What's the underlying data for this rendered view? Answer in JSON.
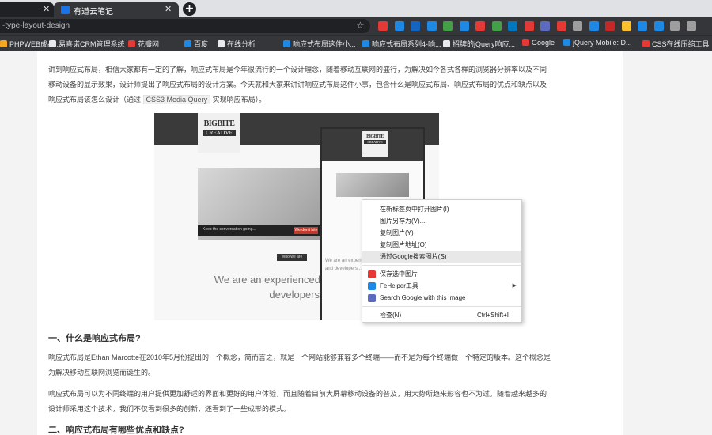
{
  "tabs": {
    "active_title": "有道云笔记",
    "close_glyph": "✕",
    "new_tab_glyph": "+"
  },
  "toolbar": {
    "url": "-type-layout-design",
    "star_glyph": "☆",
    "extension_colors": [
      "#e53935",
      "#1e88e5",
      "#1565c0",
      "#1e88e5",
      "#43a047",
      "#1e88e5",
      "#e53935",
      "#43a047",
      "#0277bd",
      "#e53935",
      "#5c6bc0",
      "#e53935",
      "#9e9e9e",
      "#1e88e5",
      "#c62828",
      "#fbc02d",
      "#1e88e5",
      "#1e88e5",
      "#9e9e9e",
      "#9e9e9e"
    ]
  },
  "bookmarks": [
    {
      "label": "PHPWEB成品...",
      "color": "#f5a623"
    },
    {
      "label": "易喜诺CRM管理系统",
      "color": "#e8eaed"
    },
    {
      "label": "花瓣网",
      "color": "#e53935"
    },
    {
      "label": "百度",
      "color": "#1e88e5"
    },
    {
      "label": "在线分析",
      "color": "#e8eaed"
    },
    {
      "label": "响应式布局这件小...",
      "color": "#1e88e5"
    },
    {
      "label": "响应式布局系列4-响...",
      "color": "#1e88e5"
    },
    {
      "label": "招牌的jQuery响应...",
      "color": "#e8eaed"
    },
    {
      "label": "Google",
      "color": "#e53935"
    },
    {
      "label": "jQuery Mobile: D...",
      "color": "#1e88e5"
    },
    {
      "label": "CSS在线压缩工具",
      "color": "#e53935"
    }
  ],
  "article": {
    "intro_part1": "讲到响应式布局，相信大家都有一定的了解，响应式布局是今年很流行的一个设计理念，随着移动互联网的盛行，为解决如今各式各样的浏览器分辨率以及不同移动设备的显示效果，设计师提出了响应式布局的设计方案。今天就和大家来讲讲响应式布局这件小事，包含什么是响应式布局、响应式布局的优点和缺点以及响应式布局该怎么设计（通过",
    "intro_code": "CSS3 Media Query",
    "intro_part2": "实现响应布局）。",
    "h1": "一、什么是响应式布局?",
    "p1": "响应式布局是Ethan Marcotte在2010年5月份提出的一个概念，简而言之，就是一个网站能够兼容多个终端——而不是为每个终端做一个特定的版本。这个概念是为解决移动互联网浏览而诞生的。",
    "p2": "响应式布局可以为不同终端的用户提供更加舒适的界面和更好的用户体验，而且随着目前大屏幕移动设备的普及，用大势所趋来形容也不为过。随着越来越多的设计师采用这个技术，我们不仅看到很多的创新，还看到了一些成形的模式。",
    "h2": "二、响应式布局有哪些优点和缺点?"
  },
  "image": {
    "logo_top": "BIGBITE",
    "logo_bottom": "CREATIVE",
    "caption": "Keep the conversation going...",
    "button": "We don't bite",
    "who_tag": "Who we are",
    "tagline": "We are an experienced team of designers and developers based in...",
    "mobile_text": "We are an experienced team of designers and developers..."
  },
  "context_menu": {
    "items": [
      {
        "label": "在新标签页中打开图片(I)"
      },
      {
        "label": "图片另存为(V)..."
      },
      {
        "label": "复制图片(Y)"
      },
      {
        "label": "复制图片地址(O)"
      },
      {
        "label": "通过Google搜索图片(S)"
      },
      {
        "label": "保存选中图片"
      },
      {
        "label": "FeHelper工具"
      },
      {
        "label": "Search Google with this image"
      },
      {
        "label": "检查(N)",
        "shortcut": "Ctrl+Shift+I"
      }
    ],
    "submenu_arrow": "▶"
  }
}
